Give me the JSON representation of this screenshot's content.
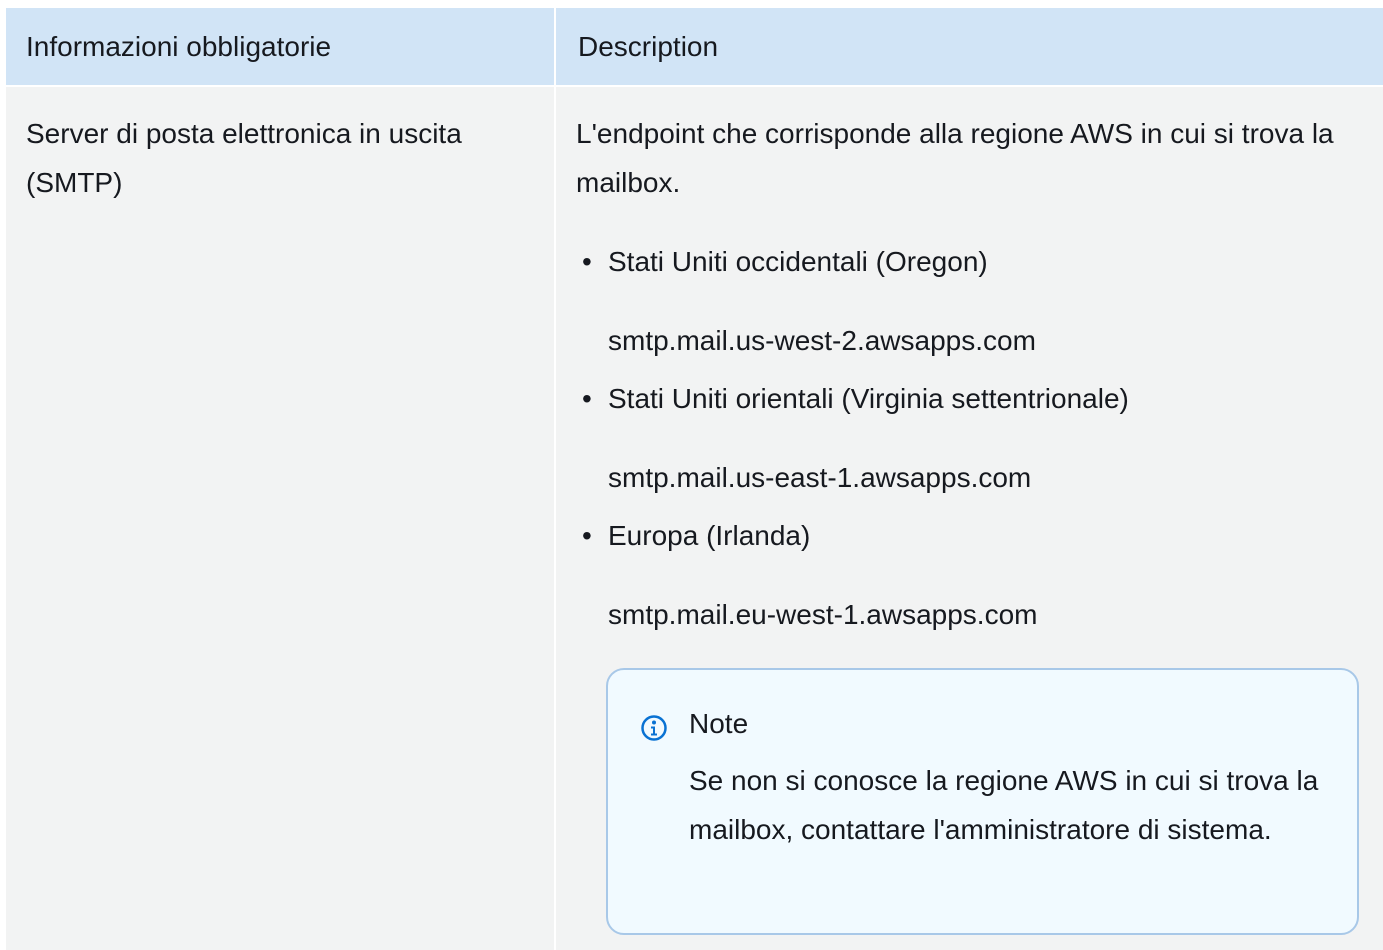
{
  "table": {
    "headers": [
      "Informazioni obbligatorie",
      "Description"
    ],
    "row": {
      "field": "Server di posta elettronica in uscita (SMTP)",
      "description": "L'endpoint che corrisponde alla regione AWS in cui si trova la mailbox.",
      "regions": [
        {
          "name": "Stati Uniti occidentali (Oregon)",
          "endpoint": "smtp.mail.us-west-2.awsapps.com"
        },
        {
          "name": "Stati Uniti orientali (Virginia settentrionale)",
          "endpoint": "smtp.mail.us-east-1.awsapps.com"
        },
        {
          "name": "Europa (Irlanda)",
          "endpoint": "smtp.mail.eu-west-1.awsapps.com"
        }
      ],
      "bullet": "•"
    }
  },
  "note": {
    "icon": "info-icon",
    "title": "Note",
    "text": "Se non si conosce la regione AWS in cui si trova la mailbox, contattare l'amministratore di sistema."
  },
  "colors": {
    "header_bg": "#d1e4f6",
    "row_bg": "#f2f3f3",
    "note_bg": "#f1faff",
    "note_border": "#a8c8e8",
    "info_icon": "#0972d3"
  }
}
